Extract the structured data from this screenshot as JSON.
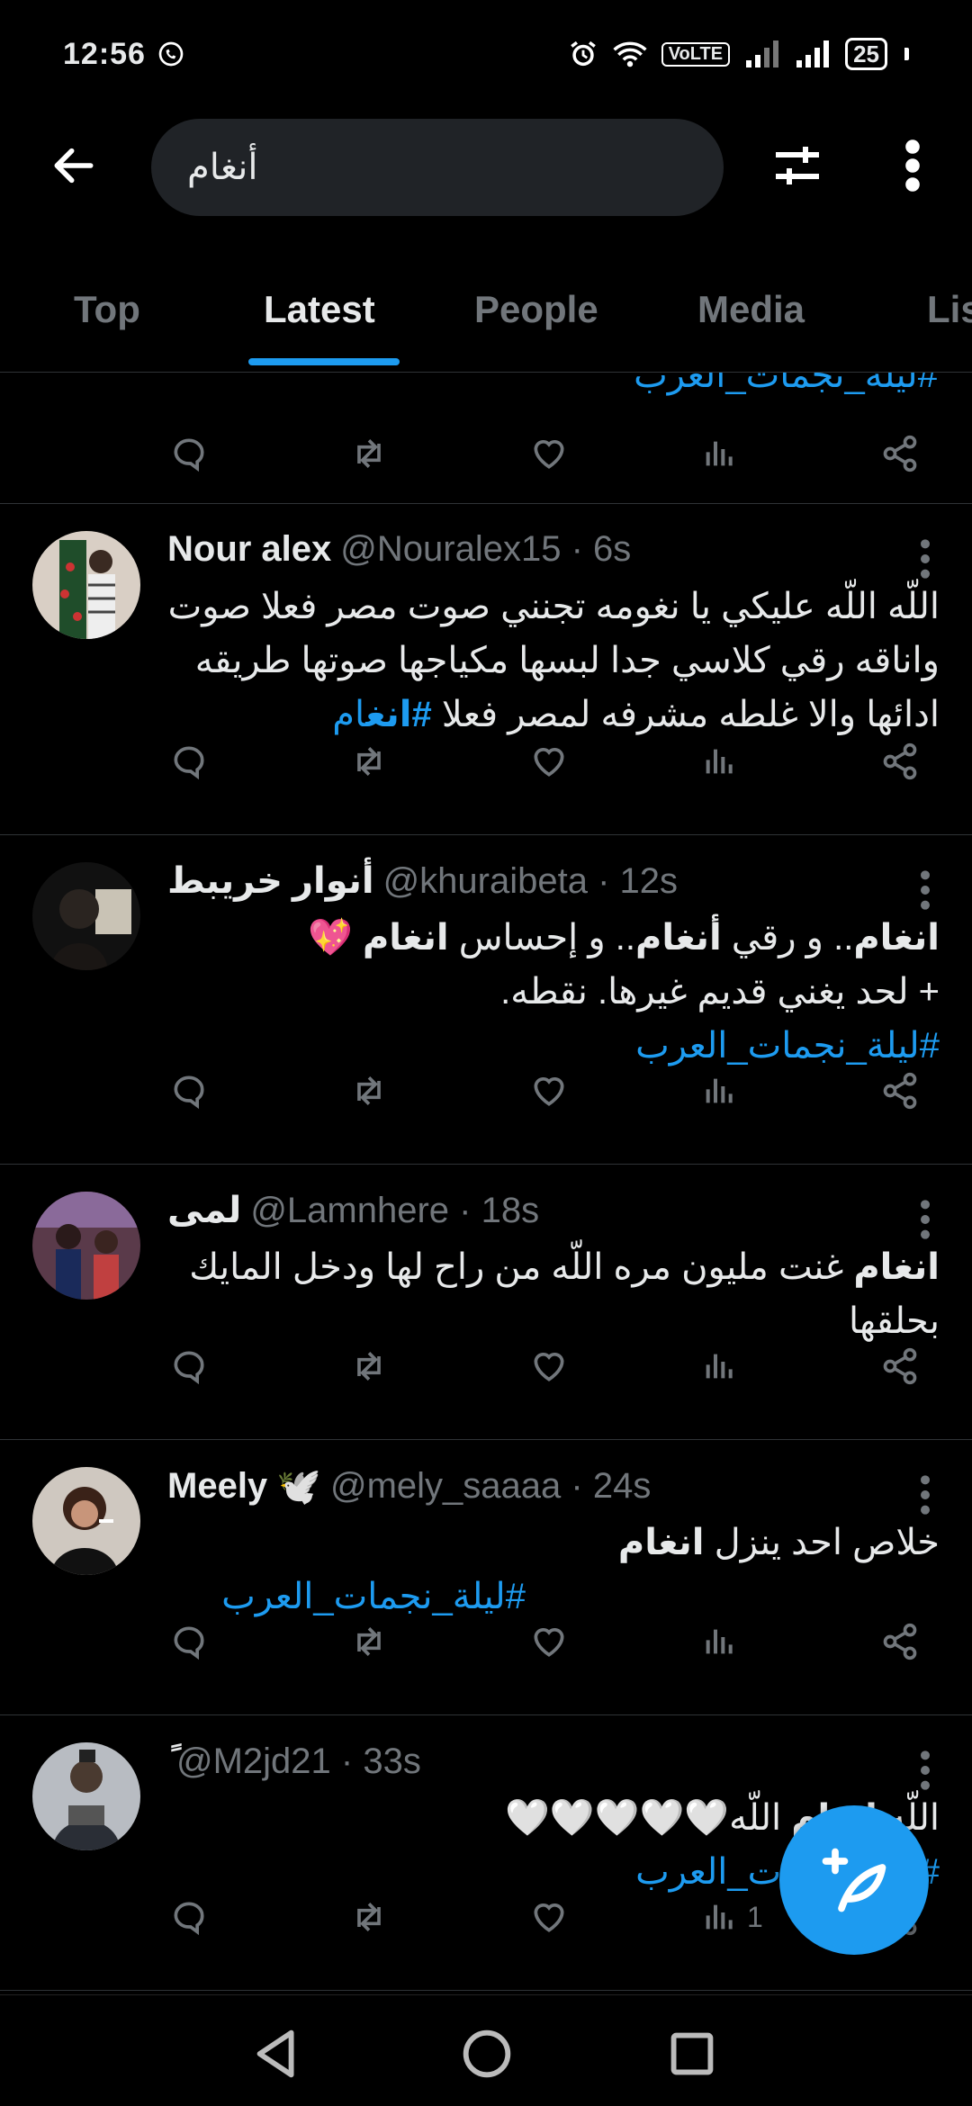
{
  "status": {
    "time": "12:56",
    "volte": "VoLTE",
    "battery": "25"
  },
  "search": {
    "query": "أنغام"
  },
  "tabs": [
    {
      "label": "Top"
    },
    {
      "label": "Latest"
    },
    {
      "label": "People"
    },
    {
      "label": "Media"
    },
    {
      "label": "Lis"
    }
  ],
  "partial": {
    "hashtag": "#ليلة_نجمات_العرب"
  },
  "tweets": [
    {
      "name": "Nour alex",
      "handle": "@Nouralex15 · 6s",
      "line1": "اللّه اللّه عليكي يا نغومه تجنني صوت مصر فعلا صوت",
      "line2": "واناقه رقي كلاسي جدا لبسها مكياجها صوتها طريقه",
      "line3": "ادائها والا غلطه مشرفه لمصر فعلا",
      "tag_a": "#انغ",
      "tag_b": "ام"
    },
    {
      "name": "أنوار خريبط",
      "handle": "@khuraibeta · 12s",
      "w1": "انغام",
      "t1": ".. و رقي ",
      "w2": "أنغام",
      "t2": ".. و إحساس ",
      "w3": "انغام",
      "emoji": "💖",
      "line2": "+ لحد يغني قديم غيرها. نقطه.",
      "tag": "#ليلة_نجمات_العرب"
    },
    {
      "name": "لمى",
      "handle": "@Lamnhere · 18s",
      "w1": "انغام",
      "t1": " غنت مليون مره اللّه من راح لها ودخل المايك",
      "line2": "بحلقها"
    },
    {
      "name": "Meely",
      "emoji": "🕊️",
      "handle": "@mely_saaaa · 24s",
      "t1": "خلاص احد ينزل ",
      "w1": "انغام",
      "tag": "#ليلة_نجمات_العرب"
    },
    {
      "name": "ً",
      "handle": "@M2jd21 · 33s",
      "t1": "اللّه ",
      "w1": "انغام",
      "t2": " اللّه🤍🤍🤍🤍🤍",
      "tag": "#ليلة_نجمات_العرب",
      "views": "1"
    }
  ],
  "colors": {
    "accent": "#1d9bf0",
    "muted": "#71767b",
    "bg": "#000000"
  }
}
